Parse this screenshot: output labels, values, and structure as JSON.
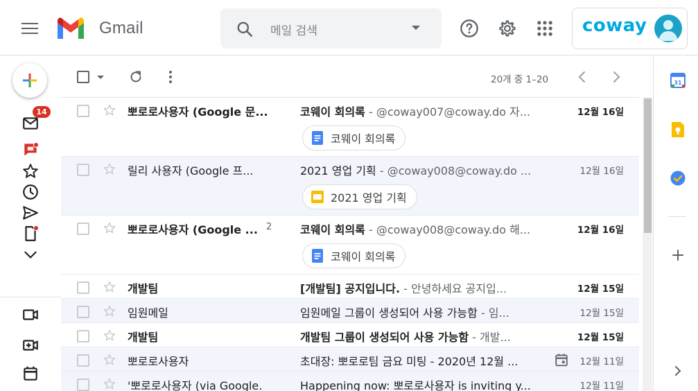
{
  "header": {
    "app_name": "Gmail",
    "search_placeholder": "메일 검색",
    "account_brand": "coway"
  },
  "rail": {
    "inbox_badge": "14"
  },
  "toolbar": {
    "pagination": "20개 중 1–20"
  },
  "colors": {
    "gmail_red": "#ea4335",
    "gmail_blue": "#4285f4",
    "gmail_green": "#34a853",
    "gmail_yellow": "#fbbc04",
    "coway_blue": "#00a9e0",
    "badge_red": "#d93025",
    "read_row_bg": "#f2f6fc"
  },
  "emails": [
    {
      "sender": "뽀로로사용자 (Google 문...",
      "subject": "코웨이 회의록",
      "snippet": " - @coway007@coway.do 자...",
      "date": "12월 16일",
      "unread": true,
      "attachment": {
        "label": "코웨이 회의록",
        "icon": "google-docs-icon"
      }
    },
    {
      "sender": "릴리 사용자 (Google 프...",
      "subject": "2021 영업 기획",
      "snippet": " - @coway008@coway.do ...",
      "date": "12월 16일",
      "unread": false,
      "attachment": {
        "label": "2021 영업 기획",
        "icon": "google-slides-icon"
      }
    },
    {
      "sender": "뽀로로사용자 (Google ...",
      "count": "2",
      "subject": "코웨이 회의록",
      "snippet": " - @coway008@coway.do 해...",
      "date": "12월 16일",
      "unread": true,
      "attachment": {
        "label": "코웨이 회의록",
        "icon": "google-docs-icon"
      }
    },
    {
      "sender": "개발팀",
      "subject": "[개발팀] 공지입니다.",
      "snippet": " - 안녕하세요 공지입...",
      "date": "12월 15일",
      "unread": true
    },
    {
      "sender": "임원메일",
      "subject": "임원메일 그룹이 생성되어 사용 가능함",
      "snippet": " - 임...",
      "date": "12월 15일",
      "unread": false
    },
    {
      "sender": "개발팀",
      "subject": "개발팀 그룹이 생성되어 사용 가능함",
      "snippet": " - 개발...",
      "date": "12월 15일",
      "unread": true
    },
    {
      "sender": "뽀로로사용자",
      "subject": "초대장: 뽀로로팀 금요 미팅 - 2020년 12월 ...",
      "snippet": "",
      "date": "12월 11일",
      "unread": false,
      "calendar_icon": true
    },
    {
      "sender": "'뽀로로사용자 (via Google.",
      "subject": "Happening now: 뽀로로사용자 is inviting y...",
      "snippet": "",
      "date": "12월 11일",
      "unread": false
    }
  ]
}
